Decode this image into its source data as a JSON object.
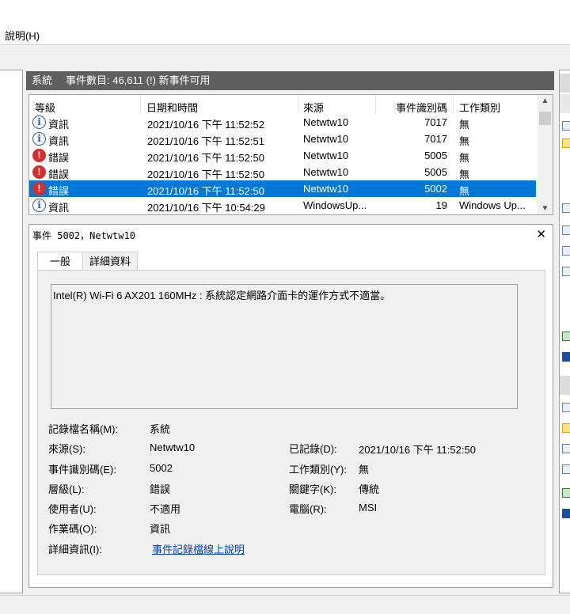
{
  "menu": {
    "help": "說明(H)"
  },
  "header": {
    "log_name": "系統",
    "summary": "事件數目: 46,611 (!) 新事件可用"
  },
  "columns": [
    "等級",
    "日期和時間",
    "來源",
    "事件識別碼",
    "工作類別"
  ],
  "rows": [
    {
      "level": "資訊",
      "type": "info",
      "datetime": "2021/10/16 下午 11:52:52",
      "source": "Netwtw10",
      "event_id": "7017",
      "category": "無"
    },
    {
      "level": "資訊",
      "type": "info",
      "datetime": "2021/10/16 下午 11:52:51",
      "source": "Netwtw10",
      "event_id": "7017",
      "category": "無"
    },
    {
      "level": "錯誤",
      "type": "error",
      "datetime": "2021/10/16 下午 11:52:50",
      "source": "Netwtw10",
      "event_id": "5005",
      "category": "無"
    },
    {
      "level": "錯誤",
      "type": "error",
      "datetime": "2021/10/16 下午 11:52:50",
      "source": "Netwtw10",
      "event_id": "5005",
      "category": "無"
    },
    {
      "level": "錯誤",
      "type": "error",
      "datetime": "2021/10/16 下午 11:52:50",
      "source": "Netwtw10",
      "event_id": "5002",
      "category": "無",
      "selected": true
    },
    {
      "level": "資訊",
      "type": "info",
      "datetime": "2021/10/16 下午 10:54:29",
      "source": "WindowsUp...",
      "event_id": "19",
      "category": "Windows Up..."
    }
  ],
  "detail": {
    "title": "事件 5002，Netwtw10",
    "tabs": {
      "general": "一般",
      "details": "詳細資料"
    },
    "description": "Intel(R) Wi-Fi 6 AX201 160MHz : 系統認定網路介面卡的運作方式不適當。",
    "labels": {
      "log_name": "記錄檔名稱(M):",
      "source": "來源(S):",
      "event_id": "事件識別碼(E):",
      "level": "層級(L):",
      "user": "使用者(U):",
      "opcode": "作業碼(O):",
      "more_info": "詳細資訊(I):",
      "logged": "已記錄(D):",
      "task_category": "工作類別(Y):",
      "keywords": "關鍵字(K):",
      "computer": "電腦(R):"
    },
    "values": {
      "log_name": "系統",
      "source": "Netwtw10",
      "event_id": "5002",
      "level": "錯誤",
      "user": "不適用",
      "opcode": "資訊",
      "more_info": "事件記錄檔線上說明",
      "logged": "2021/10/16 下午 11:52:50",
      "task_category": "無",
      "keywords": "傳統",
      "computer": "MSI"
    }
  }
}
